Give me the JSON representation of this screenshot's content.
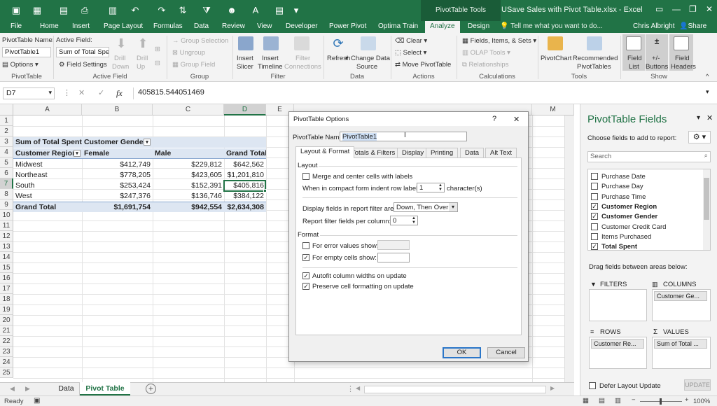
{
  "titlebar": {
    "context_tab": "PivotTable Tools",
    "title": "USave Sales with Pivot Table.xlsx - Excel"
  },
  "tabs": [
    "File",
    "Home",
    "Insert",
    "Page Layout",
    "Formulas",
    "Data",
    "Review",
    "View",
    "Developer",
    "Power Pivot",
    "Optima Train",
    "Analyze",
    "Design"
  ],
  "active_tab": "Analyze",
  "tell_me": "Tell me what you want to do...",
  "user": "Chris Albright",
  "share": "Share",
  "ribbon": {
    "pt_name_label": "PivotTable Name:",
    "pt_name_value": "PivotTable1",
    "options": "Options",
    "group_pivottable": "PivotTable",
    "active_field_label": "Active Field:",
    "active_field_value": "Sum of Total Sper",
    "field_settings": "Field Settings",
    "drill_down": [
      "Drill",
      "Down"
    ],
    "drill_up": [
      "Drill",
      "Up"
    ],
    "group_active_field": "Active Field",
    "group_selection": "Group Selection",
    "ungroup": "Ungroup",
    "group_field": "Group Field",
    "group_group": "Group",
    "insert_slicer": [
      "Insert",
      "Slicer"
    ],
    "insert_timeline": [
      "Insert",
      "Timeline"
    ],
    "filter_connections": [
      "Filter",
      "Connections"
    ],
    "group_filter": "Filter",
    "refresh": "Refresh",
    "change_data_source": [
      "Change Data",
      "Source"
    ],
    "group_data": "Data",
    "clear": "Clear",
    "select": "Select",
    "move_pivottable": "Move PivotTable",
    "group_actions": "Actions",
    "fields_items_sets": "Fields, Items, & Sets",
    "olap_tools": "OLAP Tools",
    "relationships": "Relationships",
    "group_calculations": "Calculations",
    "pivotchart": "PivotChart",
    "recommended": [
      "Recommended",
      "PivotTables"
    ],
    "group_tools": "Tools",
    "field_list": [
      "Field",
      "List"
    ],
    "buttons": [
      "+/-",
      "Buttons"
    ],
    "field_headers": [
      "Field",
      "Headers"
    ],
    "group_show": "Show"
  },
  "formula_bar": {
    "name_box": "D7",
    "fx": "fx",
    "value": "405815.544051469"
  },
  "columns": [
    "A",
    "B",
    "C",
    "D",
    "E",
    "M"
  ],
  "rows": [
    "1",
    "2",
    "3",
    "4",
    "5",
    "6",
    "7",
    "8",
    "9",
    "10",
    "11",
    "12",
    "13",
    "14",
    "15",
    "16",
    "17",
    "18",
    "19",
    "20",
    "21",
    "22",
    "23",
    "24",
    "25"
  ],
  "pivot": {
    "values_header": "Sum of Total Spent",
    "col_field": "Customer Gender",
    "row_field": "Customer Region",
    "col_labels": [
      "Female",
      "Male",
      "Grand Total"
    ],
    "rows": [
      {
        "label": "Midwest",
        "female": "$412,749",
        "male": "$229,812",
        "total": "$642,562"
      },
      {
        "label": "Northeast",
        "female": "$778,205",
        "male": "$423,605",
        "total": "$1,201,810"
      },
      {
        "label": "South",
        "female": "$253,424",
        "male": "$152,391",
        "total": "$405,816"
      },
      {
        "label": "West",
        "female": "$247,376",
        "male": "$136,746",
        "total": "$384,122"
      }
    ],
    "grand": {
      "label": "Grand Total",
      "female": "$1,691,754",
      "male": "$942,554",
      "total": "$2,634,308"
    }
  },
  "sheets": [
    "Data",
    "Pivot Table"
  ],
  "active_sheet": "Pivot Table",
  "status": {
    "ready": "Ready",
    "zoom": "100%"
  },
  "dialog": {
    "title": "PivotTable Options",
    "help": "?",
    "close": "✕",
    "name_label": "PivotTable Name:",
    "name_value": "PivotTable1",
    "tabs": [
      "Layout & Format",
      "Totals & Filters",
      "Display",
      "Printing",
      "Data",
      "Alt Text"
    ],
    "active_tab": "Layout & Format",
    "layout_section": "Layout",
    "merge_center": "Merge and center cells with labels",
    "merge_center_checked": false,
    "indent_label": "When in compact form indent row labels:",
    "indent_value": "1",
    "indent_unit": "character(s)",
    "display_fields_label": "Display fields in report filter area:",
    "display_fields_value": "Down, Then Over",
    "report_filter_label": "Report filter fields per column:",
    "report_filter_value": "0",
    "format_section": "Format",
    "error_values": "For error values show:",
    "error_checked": false,
    "empty_cells": "For empty cells show:",
    "empty_checked": true,
    "autofit": "Autofit column widths on update",
    "autofit_checked": true,
    "preserve": "Preserve cell formatting on update",
    "preserve_checked": true,
    "ok": "OK",
    "cancel": "Cancel"
  },
  "pane": {
    "title": "PivotTable Fields",
    "subtitle": "Choose fields to add to report:",
    "search_placeholder": "Search",
    "fields": [
      {
        "name": "Purchase Date",
        "checked": false,
        "bold": false
      },
      {
        "name": "Purchase Day",
        "checked": false,
        "bold": false
      },
      {
        "name": "Purchase Time",
        "checked": false,
        "bold": false
      },
      {
        "name": "Customer Region",
        "checked": true,
        "bold": true
      },
      {
        "name": "Customer Gender",
        "checked": true,
        "bold": true
      },
      {
        "name": "Customer Credit Card",
        "checked": false,
        "bold": false
      },
      {
        "name": "Items Purchased",
        "checked": false,
        "bold": false
      },
      {
        "name": "Total Spent",
        "checked": true,
        "bold": true
      }
    ],
    "drag_label": "Drag fields between areas below:",
    "filters": "FILTERS",
    "columns": "COLUMNS",
    "columns_chip": "Customer Ge...",
    "rows": "ROWS",
    "rows_chip": "Customer Re...",
    "values": "VALUES",
    "values_chip": "Sum of Total ...",
    "defer": "Defer Layout Update",
    "update": "UPDATE"
  },
  "colors": {
    "excel_green": "#217346",
    "pivot_blue": "#dde6f2",
    "selected": "#217346"
  }
}
